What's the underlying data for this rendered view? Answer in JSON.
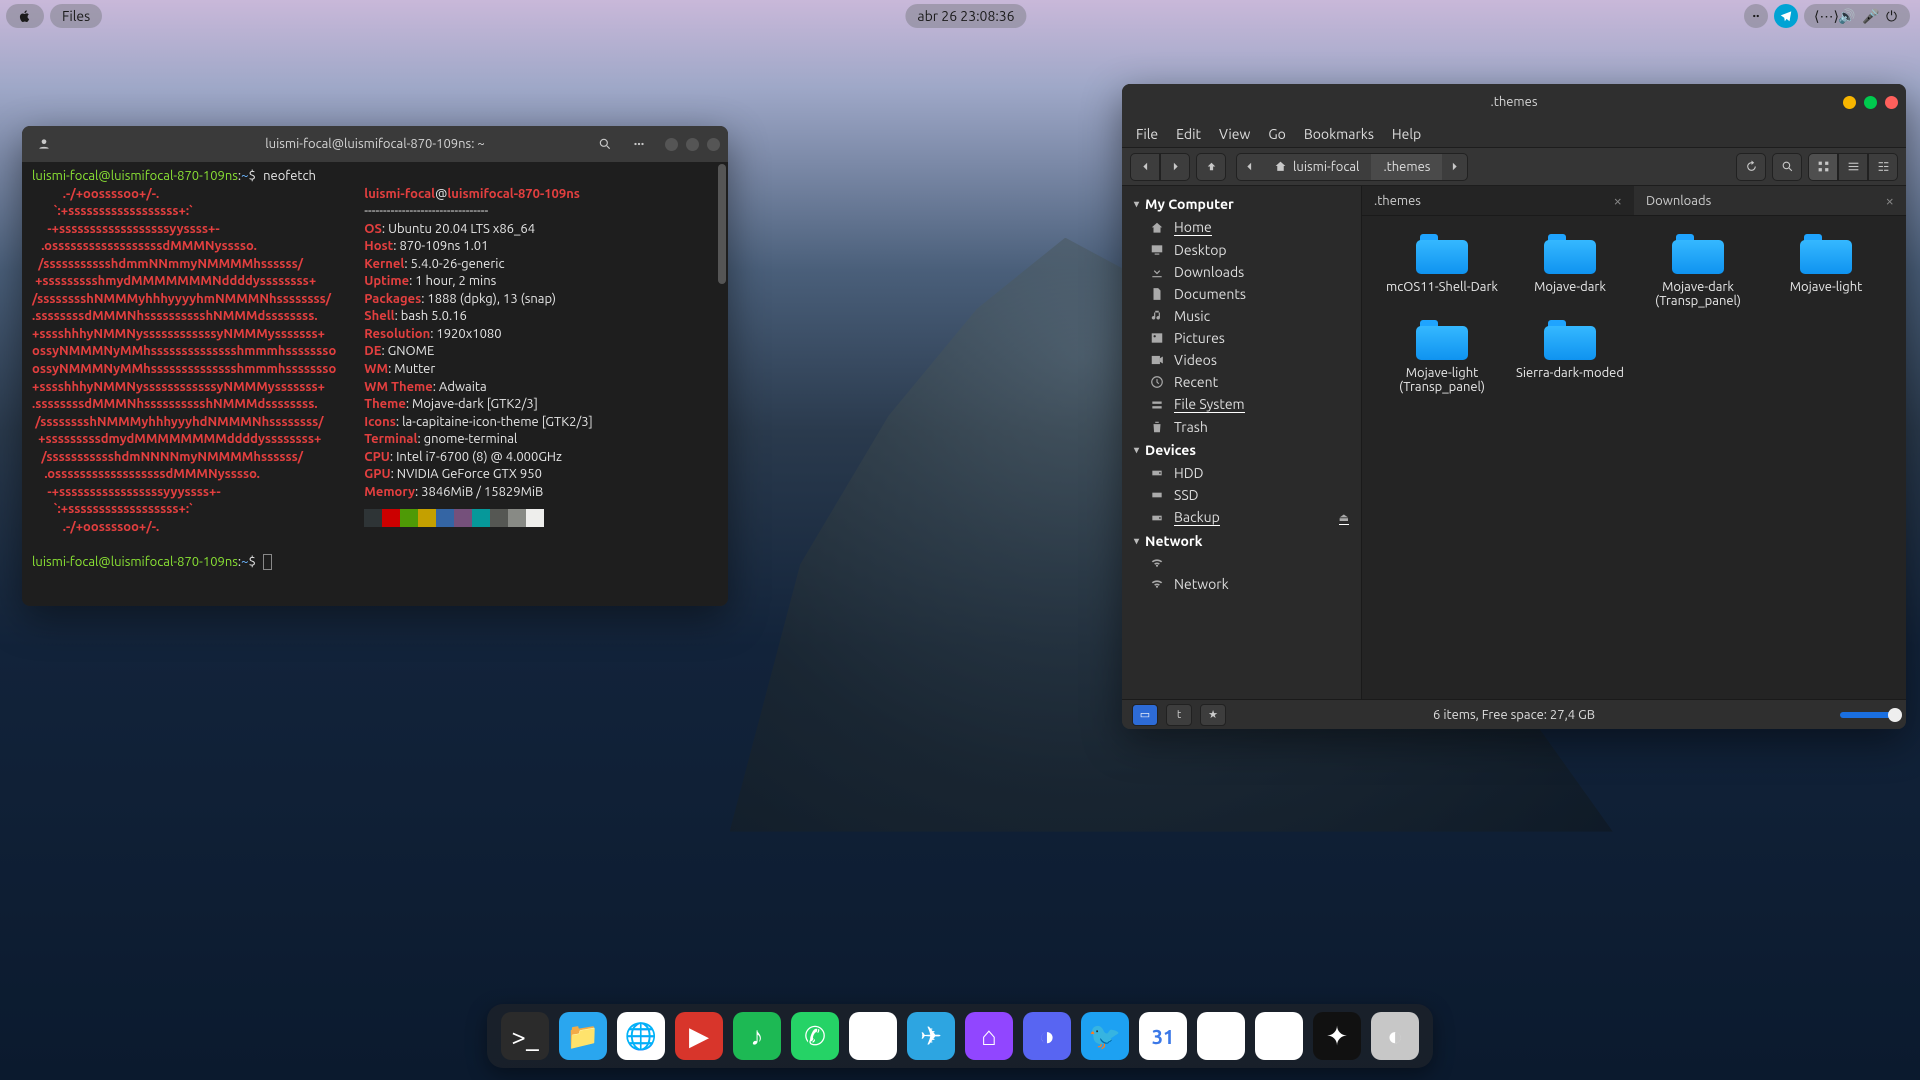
{
  "topbar": {
    "apple": "apple-icon",
    "files_label": "Files",
    "clock": "abr 26  23:08:36"
  },
  "terminal": {
    "title": "luismi-focal@luismifocal-870-109ns: ~",
    "prompt_user": "luismi-focal@luismifocal-870-109ns",
    "prompt_sep": ":",
    "prompt_path": "~",
    "prompt_sym": "$",
    "command": "neofetch",
    "logo": "          .-/+oossssoo+/-.\n       `:+ssssssssssssssssss+:`\n     -+ssssssssssssssssssyyssss+-\n   .ossssssssssssssssssdMMMNysssso.\n  /ssssssssssshdmmNNmmyNMMMMhssssss/\n +ssssssssshmydMMMMMMMNddddyssssssss+\n/sssssssshNMMMyhhhyyyyhmNMMMNhssssssss/\n.ssssssssdMMMNhsssssssssshNMMMdssssssss.\n+sssshhhyNMMNyssssssssssssyNMMMysssssss+\nossyNMMMNyMMhsssssssssssssshmmmhssssssso\nossyNMMMNyMMhsssssssssssssshmmmhssssssso\n+sssshhhyNMMNyssssssssssssyNMMMysssssss+\n.ssssssssdMMMNhsssssssssshNMMMdssssssss.\n /sssssssshNMMMyhhhyyyhdNMMMNhssssssss/\n  +sssssssssdmydMMMMMMMMddddyssssssss+\n   /ssssssssssshdmNNNNmyNMMMMhssssss/\n    .ossssssssssssssssssdMMMNysssso.\n     -+sssssssssssssssssyyyssss+-\n       `:+ssssssssssssssssss+:`\n          .-/+oossssoo+/-.",
    "info_user": "luismi-focal",
    "info_at": "@",
    "info_host": "luismifocal-870-109ns",
    "rows": [
      {
        "k": "OS",
        "v": ": Ubuntu 20.04 LTS x86_64"
      },
      {
        "k": "Host",
        "v": ": 870-109ns 1.01"
      },
      {
        "k": "Kernel",
        "v": ": 5.4.0-26-generic"
      },
      {
        "k": "Uptime",
        "v": ": 1 hour, 2 mins"
      },
      {
        "k": "Packages",
        "v": ": 1888 (dpkg), 13 (snap)"
      },
      {
        "k": "Shell",
        "v": ": bash 5.0.16"
      },
      {
        "k": "Resolution",
        "v": ": 1920x1080"
      },
      {
        "k": "DE",
        "v": ": GNOME"
      },
      {
        "k": "WM",
        "v": ": Mutter"
      },
      {
        "k": "WM Theme",
        "v": ": Adwaita"
      },
      {
        "k": "Theme",
        "v": ": Mojave-dark [GTK2/3]"
      },
      {
        "k": "Icons",
        "v": ": la-capitaine-icon-theme [GTK2/3]"
      },
      {
        "k": "Terminal",
        "v": ": gnome-terminal"
      },
      {
        "k": "CPU",
        "v": ": Intel i7-6700 (8) @ 4.000GHz"
      },
      {
        "k": "GPU",
        "v": ": NVIDIA GeForce GTX 950"
      },
      {
        "k": "Memory",
        "v": ": 3846MiB / 15829MiB"
      }
    ],
    "palette": [
      "#2e3436",
      "#cc0000",
      "#4e9a06",
      "#c4a000",
      "#3465a4",
      "#75507b",
      "#06989a",
      "#555753",
      "#888a85",
      "#eeeeec"
    ]
  },
  "fm": {
    "title": ".themes",
    "menus": [
      "File",
      "Edit",
      "View",
      "Go",
      "Bookmarks",
      "Help"
    ],
    "path_user": "luismi-focal",
    "path_current": ".themes",
    "sidebar": {
      "computer_head": "My Computer",
      "computer": [
        {
          "icon": "home",
          "label": "Home",
          "sel": true
        },
        {
          "icon": "desktop",
          "label": "Desktop"
        },
        {
          "icon": "download",
          "label": "Downloads"
        },
        {
          "icon": "doc",
          "label": "Documents"
        },
        {
          "icon": "music",
          "label": "Music"
        },
        {
          "icon": "picture",
          "label": "Pictures"
        },
        {
          "icon": "video",
          "label": "Videos"
        },
        {
          "icon": "recent",
          "label": "Recent"
        },
        {
          "icon": "fs",
          "label": "File System",
          "sel": true
        },
        {
          "icon": "trash",
          "label": "Trash"
        }
      ],
      "devices_head": "Devices",
      "devices": [
        {
          "icon": "hdd",
          "label": "HDD"
        },
        {
          "icon": "ssd",
          "label": "SSD"
        },
        {
          "icon": "backup",
          "label": "Backup",
          "sel": true,
          "eject": true
        }
      ],
      "network_head": "Network",
      "network": [
        {
          "icon": "wifi",
          "label": ""
        },
        {
          "icon": "wifi",
          "label": "Network"
        }
      ]
    },
    "tabs": [
      {
        "label": ".themes",
        "active": true
      },
      {
        "label": "Downloads"
      }
    ],
    "items": [
      "mcOS11-Shell-Dark",
      "Mojave-dark",
      "Mojave-dark (Transp_panel)",
      "Mojave-light",
      "Mojave-light (Transp_panel)",
      "Sierra-dark-moded"
    ],
    "status": "6 items, Free space: 27,4 GB"
  },
  "dock": [
    {
      "name": "terminal",
      "bg": "#2b2b2b",
      "glyph": ">_"
    },
    {
      "name": "files",
      "bg": "#2aa6ef",
      "glyph": "📁"
    },
    {
      "name": "chrome",
      "bg": "#ffffff",
      "glyph": "🌐"
    },
    {
      "name": "youtube",
      "bg": "#d8352b",
      "glyph": "▶"
    },
    {
      "name": "spotify",
      "bg": "#1db954",
      "glyph": "♪"
    },
    {
      "name": "whatsapp",
      "bg": "#25d366",
      "glyph": "✆"
    },
    {
      "name": "instagram",
      "bg": "#ffffff",
      "glyph": "◉"
    },
    {
      "name": "telegram",
      "bg": "#2da5e1",
      "glyph": "✈"
    },
    {
      "name": "twitch",
      "bg": "#9146ff",
      "glyph": "⌂"
    },
    {
      "name": "discord",
      "bg": "#5865f2",
      "glyph": "◑"
    },
    {
      "name": "twitter",
      "bg": "#1da1f2",
      "glyph": "🐦"
    },
    {
      "name": "calendar",
      "bg": "#ffffff",
      "glyph": "31"
    },
    {
      "name": "gmail",
      "bg": "#ffffff",
      "glyph": "✉"
    },
    {
      "name": "drive",
      "bg": "#ffffff",
      "glyph": "△"
    },
    {
      "name": "photos",
      "bg": "#111111",
      "glyph": "✦"
    },
    {
      "name": "steam",
      "bg": "#c7c7c7",
      "glyph": "◐"
    }
  ]
}
